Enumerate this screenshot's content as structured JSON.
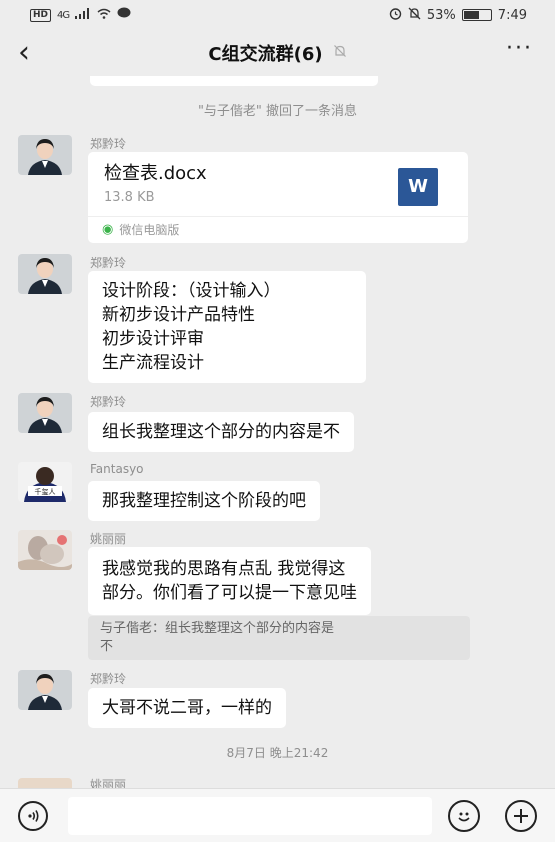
{
  "status_bar": {
    "hd": "HD",
    "network": "4G",
    "battery_text": "53%",
    "battery_level": 0.53,
    "time": "7:49"
  },
  "header": {
    "title": "C组交流群(6)",
    "back_icon": "chevron-left-icon",
    "mute_icon": "bell-off-icon",
    "more_label": "···"
  },
  "chat": {
    "recall_notice": "\"与子偕老\" 撤回了一条消息",
    "messages": [
      {
        "sender": "郑黔玲",
        "type": "file",
        "file_name": "检查表.docx",
        "file_size": "13.8 KB",
        "file_icon": "W",
        "source": "微信电脑版"
      },
      {
        "sender": "郑黔玲",
        "type": "text",
        "lines": [
          "设计阶段：（设计输入）",
          "新初步设计产品特性",
          "初步设计评审",
          "生产流程设计"
        ]
      },
      {
        "sender": "郑黔玲",
        "type": "text",
        "lines": [
          "组长我整理这个部分的内容是不"
        ]
      },
      {
        "sender": "Fantasyo",
        "type": "text",
        "lines": [
          "那我整理控制这个阶段的吧"
        ]
      },
      {
        "sender": "姚丽丽",
        "type": "text",
        "lines": [
          "我感觉我的思路有点乱  我觉得这",
          "部分。你们看了可以提一下意见哇"
        ],
        "quote_lines": [
          "与子偕老：组长我整理这个部分的内容是",
          "不"
        ]
      },
      {
        "sender": "郑黔玲",
        "type": "text",
        "lines": [
          "大哥不说二哥，一样的"
        ]
      }
    ],
    "timestamp": "8月7日 晚上21:42",
    "cut_sender": "姚丽丽"
  },
  "input_bar": {
    "voice_icon": "voice-icon",
    "emoji_icon": "emoji-icon",
    "plus_icon": "plus-icon"
  }
}
